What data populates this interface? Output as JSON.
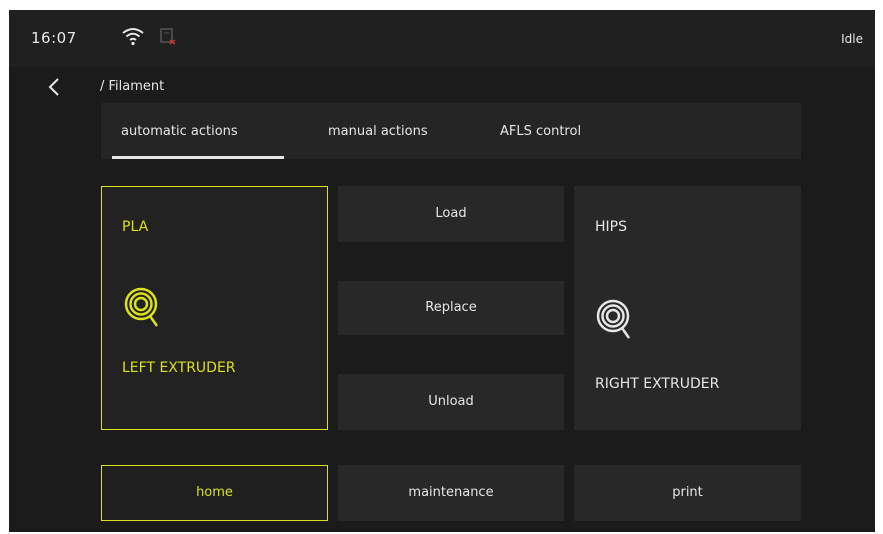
{
  "status_bar": {
    "time": "16:07",
    "wifi_icon": "wifi-icon",
    "network_icon": "network-disconnected-icon",
    "state": "Idle"
  },
  "nav": {
    "back_icon": "chevron-left-icon",
    "breadcrumb": "/ Filament"
  },
  "tabs": [
    {
      "label": "automatic actions",
      "active": true
    },
    {
      "label": "manual actions",
      "active": false
    },
    {
      "label": "AFLS control",
      "active": false
    }
  ],
  "extruders": {
    "left": {
      "material": "PLA",
      "label": "LEFT EXTRUDER",
      "icon": "filament-spool-icon",
      "selected": true
    },
    "right": {
      "material": "HIPS",
      "label": "RIGHT EXTRUDER",
      "icon": "filament-spool-icon",
      "selected": false
    }
  },
  "actions": {
    "load": "Load",
    "replace": "Replace",
    "unload": "Unload"
  },
  "bottom_nav": {
    "home": "home",
    "maintenance": "maintenance",
    "print": "print"
  },
  "colors": {
    "accent": "#dbe11d",
    "background": "#1b1b1b",
    "panel": "#282828",
    "text": "#e6e6e6"
  }
}
